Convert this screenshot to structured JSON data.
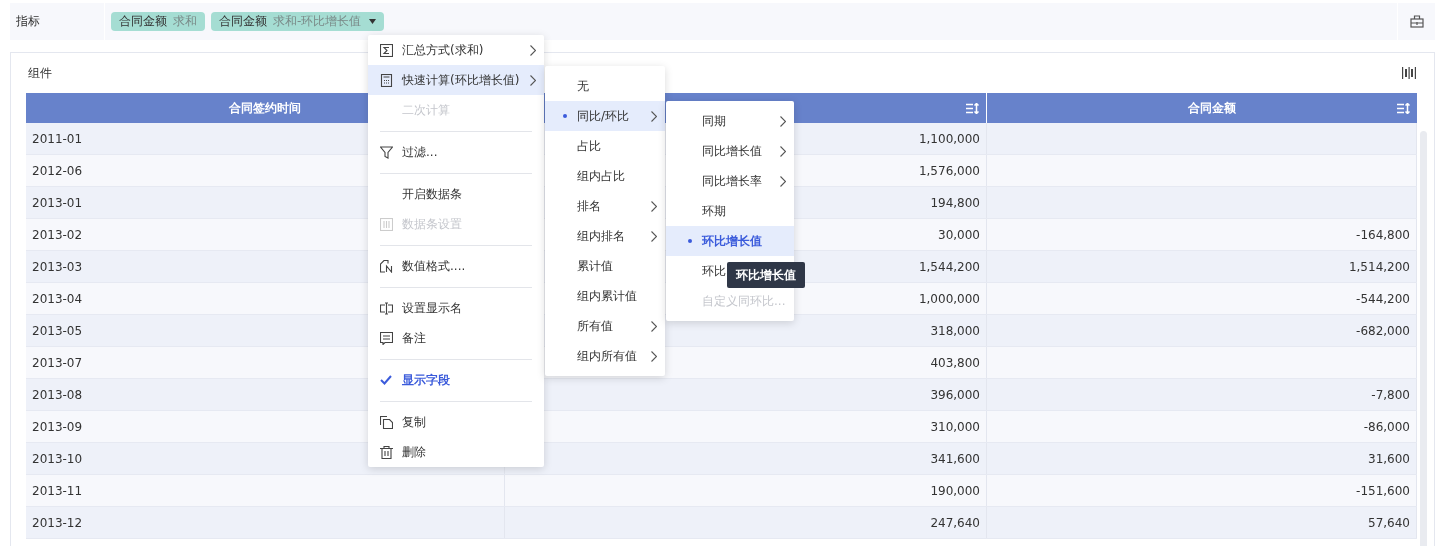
{
  "filter_bar": {
    "label": "指标",
    "chips": [
      {
        "field": "合同金额",
        "aggregate": "求和",
        "dropdown": false
      },
      {
        "field": "合同金额",
        "aggregate": "求和-环比增长值",
        "dropdown": true
      }
    ]
  },
  "panel": {
    "title": "组件"
  },
  "table": {
    "columns": [
      {
        "header": "合同签约时间",
        "sortable": false
      },
      {
        "sortable": true
      },
      {
        "header": "合同金额",
        "sortable": true
      }
    ],
    "rows": [
      [
        "2011-01",
        "1,100,000",
        ""
      ],
      [
        "2012-06",
        "1,576,000",
        ""
      ],
      [
        "2013-01",
        "194,800",
        ""
      ],
      [
        "2013-02",
        "30,000",
        "-164,800"
      ],
      [
        "2013-03",
        "1,544,200",
        "1,514,200"
      ],
      [
        "2013-04",
        "1,000,000",
        "-544,200"
      ],
      [
        "2013-05",
        "318,000",
        "-682,000"
      ],
      [
        "2013-07",
        "403,800",
        ""
      ],
      [
        "2013-08",
        "396,000",
        "-7,800"
      ],
      [
        "2013-09",
        "310,000",
        "-86,000"
      ],
      [
        "2013-10",
        "341,600",
        "31,600"
      ],
      [
        "2013-11",
        "190,000",
        "-151,600"
      ],
      [
        "2013-12",
        "247,640",
        "57,640"
      ]
    ]
  },
  "context_menu": {
    "items": [
      {
        "kind": "item",
        "label": "汇总方式(求和)",
        "submenu": true,
        "disabled": false,
        "expanded": false,
        "checked": false
      },
      {
        "kind": "item",
        "label": "快速计算(环比增长值)",
        "submenu": true,
        "disabled": false,
        "expanded": true,
        "checked": false
      },
      {
        "kind": "item",
        "label": "二次计算",
        "submenu": false,
        "disabled": true,
        "expanded": false,
        "checked": false
      },
      {
        "kind": "divider"
      },
      {
        "kind": "item",
        "label": "过滤...",
        "submenu": false,
        "disabled": false,
        "expanded": false,
        "checked": false
      },
      {
        "kind": "divider"
      },
      {
        "kind": "item",
        "label": "开启数据条",
        "submenu": false,
        "disabled": false,
        "expanded": false,
        "checked": false
      },
      {
        "kind": "item",
        "label": "数据条设置",
        "submenu": false,
        "disabled": true,
        "expanded": false,
        "checked": false
      },
      {
        "kind": "divider"
      },
      {
        "kind": "item",
        "label": "数值格式....",
        "submenu": false,
        "disabled": false,
        "expanded": false,
        "checked": false
      },
      {
        "kind": "divider"
      },
      {
        "kind": "item",
        "label": "设置显示名",
        "submenu": false,
        "disabled": false,
        "expanded": false,
        "checked": false
      },
      {
        "kind": "item",
        "label": "备注",
        "submenu": false,
        "disabled": false,
        "expanded": false,
        "checked": false
      },
      {
        "kind": "divider"
      },
      {
        "kind": "item",
        "label": "显示字段",
        "submenu": false,
        "disabled": false,
        "expanded": false,
        "checked": true
      },
      {
        "kind": "divider"
      },
      {
        "kind": "item",
        "label": "复制",
        "submenu": false,
        "disabled": false,
        "expanded": false,
        "checked": false
      },
      {
        "kind": "item",
        "label": "删除",
        "submenu": false,
        "disabled": false,
        "expanded": false,
        "checked": false
      }
    ]
  },
  "quick_calc_menu": {
    "items": [
      {
        "label": "无",
        "submenu": false,
        "selected": false,
        "disabled": false
      },
      {
        "label": "同比/环比",
        "submenu": true,
        "selected": true,
        "disabled": false
      },
      {
        "label": "占比",
        "submenu": false,
        "selected": false,
        "disabled": false
      },
      {
        "label": "组内占比",
        "submenu": false,
        "selected": false,
        "disabled": false
      },
      {
        "label": "排名",
        "submenu": true,
        "selected": false,
        "disabled": false
      },
      {
        "label": "组内排名",
        "submenu": true,
        "selected": false,
        "disabled": false
      },
      {
        "label": "累计值",
        "submenu": false,
        "selected": false,
        "disabled": false
      },
      {
        "label": "组内累计值",
        "submenu": false,
        "selected": false,
        "disabled": false
      },
      {
        "label": "所有值",
        "submenu": true,
        "selected": false,
        "disabled": false
      },
      {
        "label": "组内所有值",
        "submenu": true,
        "selected": false,
        "disabled": false
      }
    ]
  },
  "compare_menu": {
    "items": [
      {
        "label": "同期",
        "submenu": true,
        "selected": false,
        "disabled": false
      },
      {
        "label": "同比增长值",
        "submenu": true,
        "selected": false,
        "disabled": false
      },
      {
        "label": "同比增长率",
        "submenu": true,
        "selected": false,
        "disabled": false
      },
      {
        "label": "环期",
        "submenu": false,
        "selected": false,
        "disabled": false
      },
      {
        "label": "环比增长值",
        "submenu": false,
        "selected": true,
        "disabled": false
      },
      {
        "label": "环比",
        "submenu": false,
        "selected": false,
        "disabled": false
      },
      {
        "label": "自定义同环比...",
        "submenu": false,
        "selected": false,
        "disabled": true
      }
    ]
  },
  "tooltip": {
    "text": "环比增长值"
  }
}
